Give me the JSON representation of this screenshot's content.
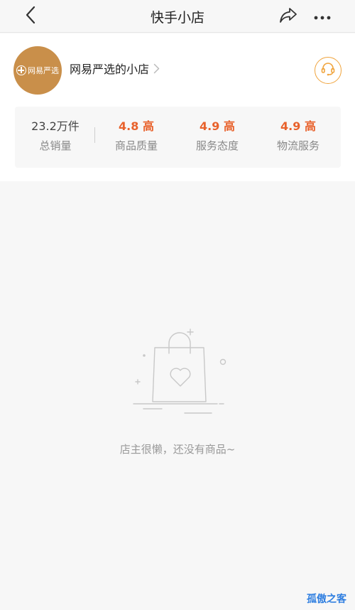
{
  "header": {
    "title": "快手小店",
    "back_icon": "chevron-left-icon",
    "share_icon": "share-icon",
    "more_icon": "more-dots-icon"
  },
  "shop": {
    "avatar_text": "网易严选",
    "name": "网易严选的小店",
    "service_icon": "headset-icon",
    "avatar_color": "#c98f4a",
    "accent_color": "#f0a43d"
  },
  "stats": [
    {
      "value": "23.2万件",
      "label": "总销量"
    },
    {
      "value": "4.8 高",
      "label": "商品质量"
    },
    {
      "value": "4.9 高",
      "label": "服务态度"
    },
    {
      "value": "4.9 高",
      "label": "物流服务"
    }
  ],
  "empty_state": {
    "icon": "shopping-bag-heart-icon",
    "message": "店主很懒，还没有商品~"
  },
  "watermark": "孤傲之客"
}
